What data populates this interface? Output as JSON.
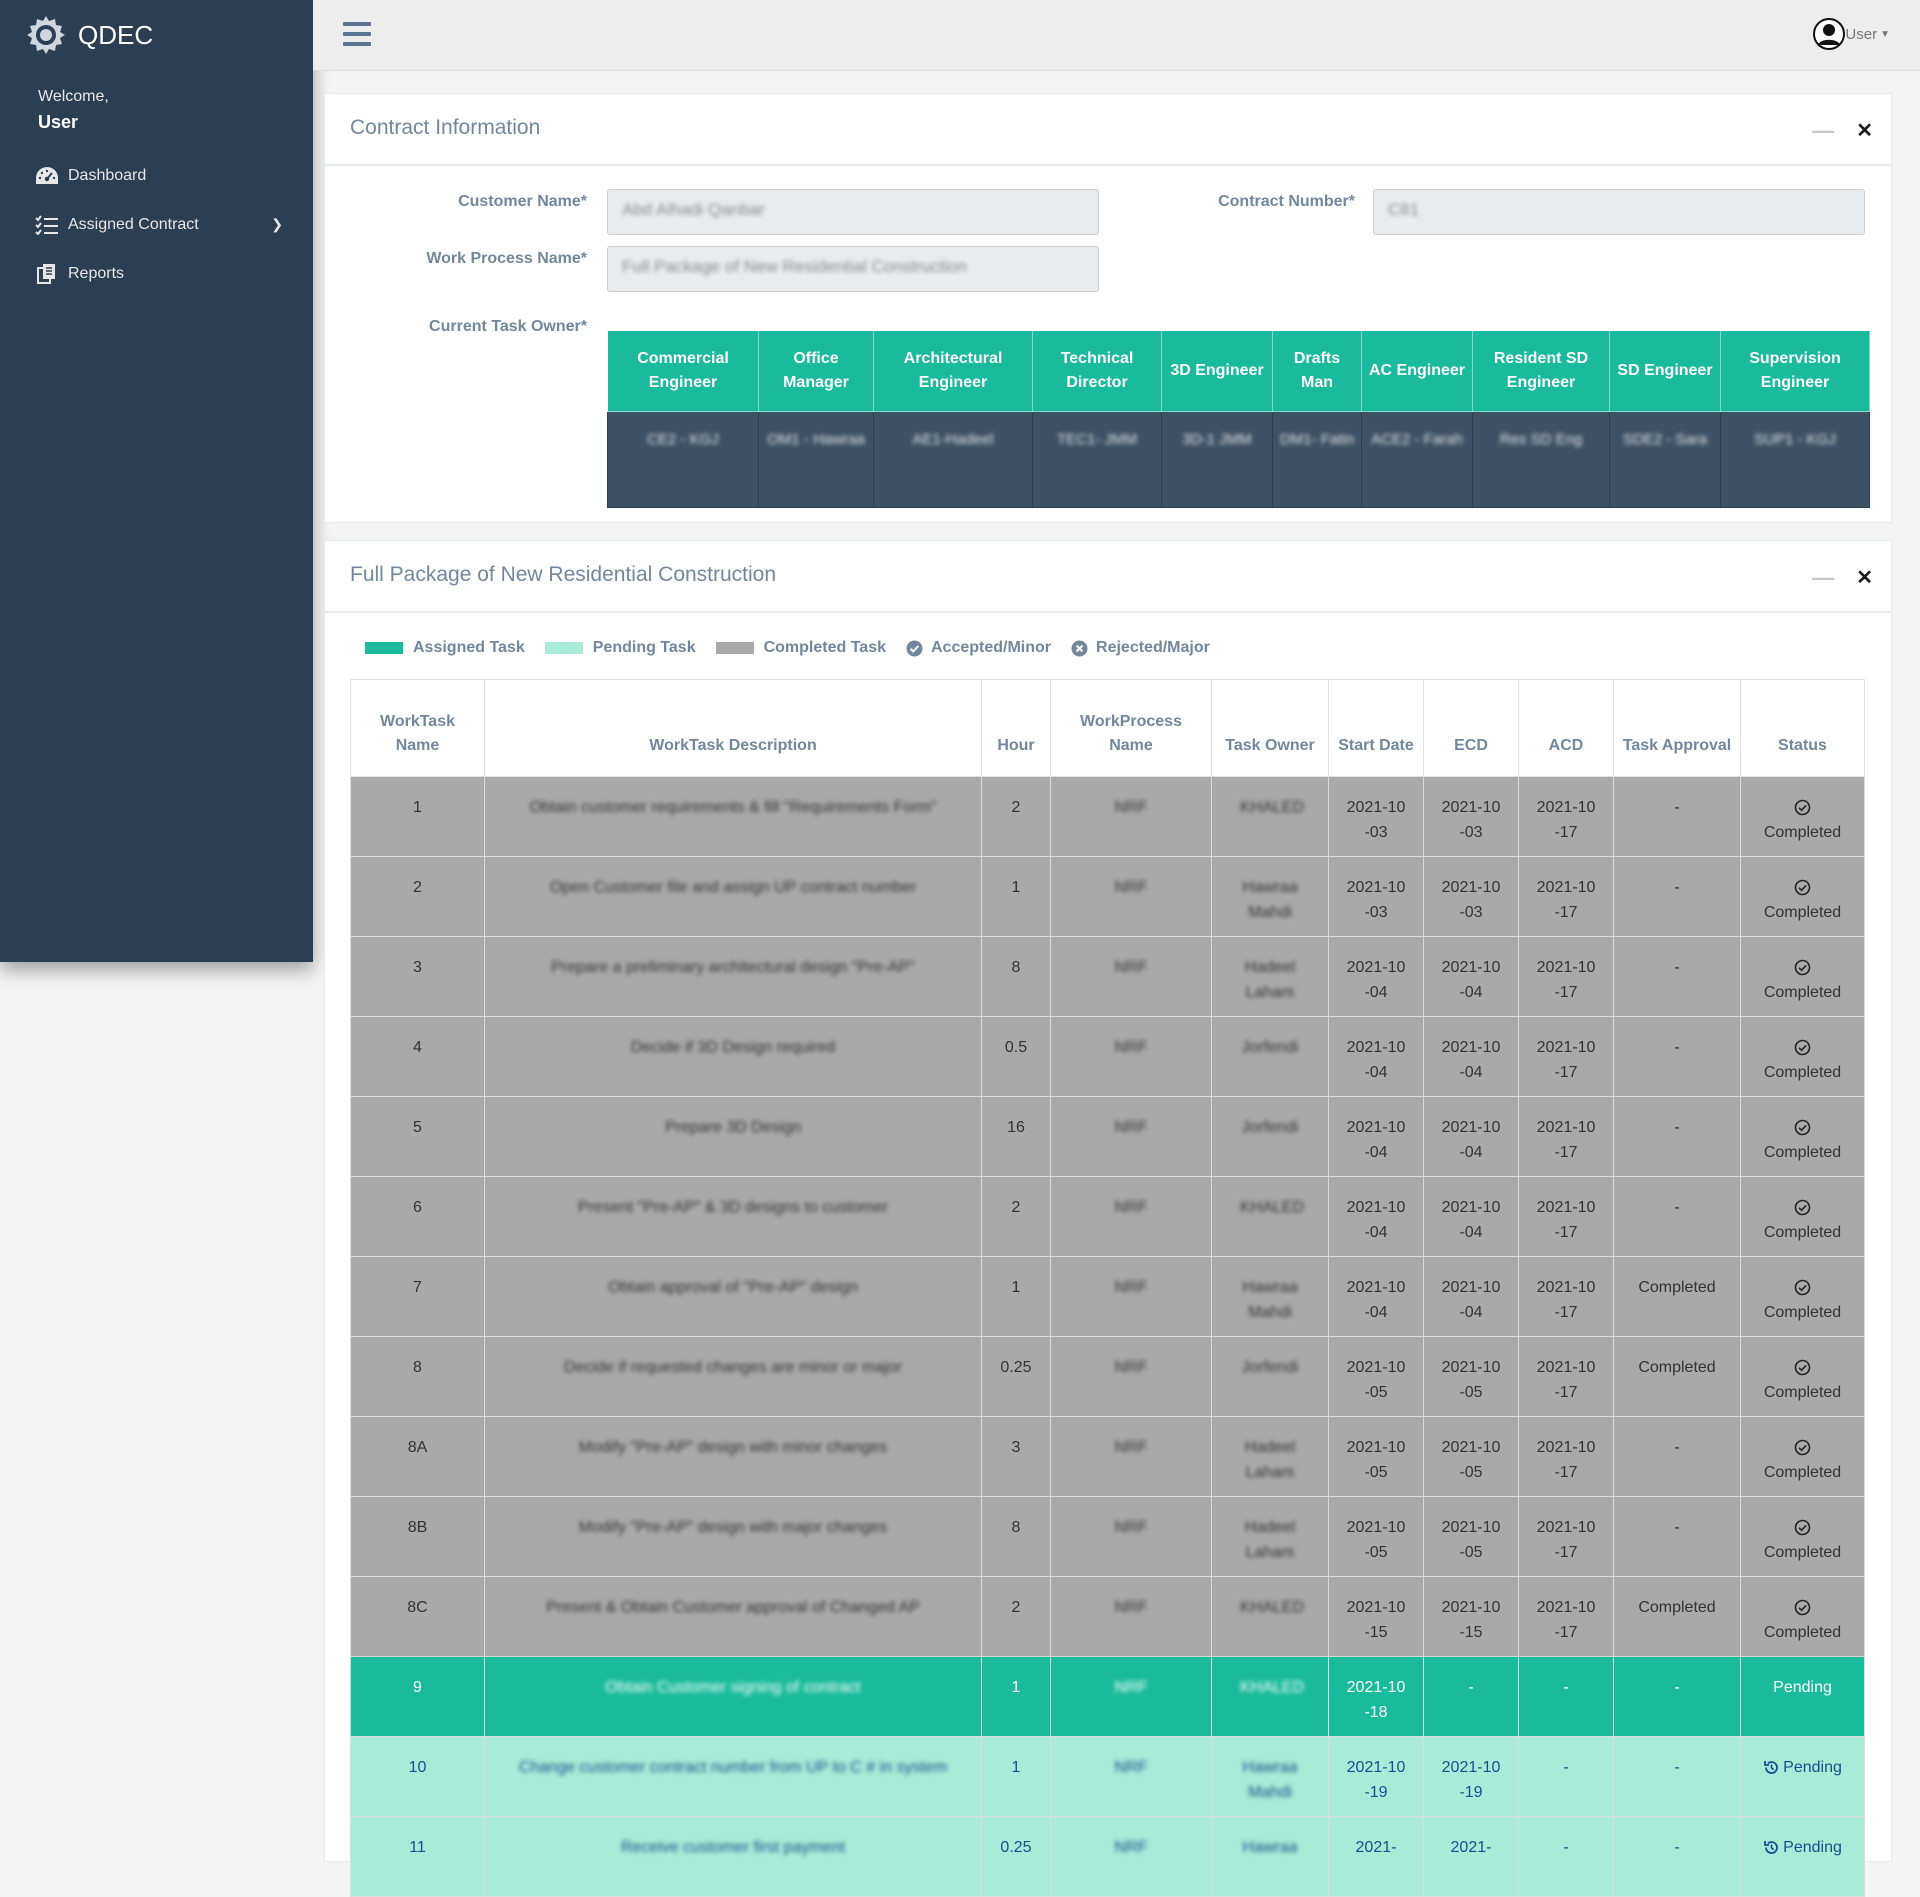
{
  "brand": {
    "name": "QDEC"
  },
  "sidebar": {
    "welcome": "Welcome,",
    "user": "User",
    "items": [
      {
        "label": "Dashboard",
        "icon": "dashboard-icon"
      },
      {
        "label": "Assigned Contract",
        "icon": "task-list-icon"
      },
      {
        "label": "Reports",
        "icon": "copy-icon"
      }
    ]
  },
  "topbar": {
    "user_label": "User"
  },
  "contract_panel": {
    "title": "Contract Information",
    "customer_name_label": "Customer Name*",
    "customer_name_value": "Abd Alhadi Qanbar",
    "contract_number_label": "Contract Number*",
    "contract_number_value": "C81",
    "work_process_label": "Work Process Name*",
    "work_process_value": "Full Package of New Residential Construction",
    "current_owner_label": "Current Task Owner*",
    "owners": [
      {
        "role": "Commercial Engineer",
        "name": "CE2 - KGJ"
      },
      {
        "role": "Office Manager",
        "name": "OM1 - Hawraa"
      },
      {
        "role": "Architectural Engineer",
        "name": "AE1-Hadeel"
      },
      {
        "role": "Technical Director",
        "name": "TEC1- JMM"
      },
      {
        "role": "3D Engineer",
        "name": "3D-1 JMM"
      },
      {
        "role": "Drafts Man",
        "name": "DM1- Fatin"
      },
      {
        "role": "AC Engineer",
        "name": "ACE2 - Farah"
      },
      {
        "role": "Resident SD Engineer",
        "name": "Res SD Eng"
      },
      {
        "role": "SD Engineer",
        "name": "SDE2 - Sara"
      },
      {
        "role": "Supervision Engineer",
        "name": "SUP1 - KGJ"
      }
    ]
  },
  "tasks_panel": {
    "title": "Full Package of New Residential Construction",
    "legend": {
      "assigned": "Assigned Task",
      "pending": "Pending Task",
      "completed": "Completed Task",
      "accepted": "Accepted/Minor",
      "rejected": "Rejected/Major"
    },
    "colors": {
      "assigned": "#1abb9c",
      "pending": "#a8ebd6",
      "completed": "#a9a9a9"
    },
    "headers": [
      "WorkTask Name",
      "WorkTask Description",
      "Hour",
      "WorkProcess Name",
      "Task Owner",
      "Start Date",
      "ECD",
      "ACD",
      "Task Approval",
      "Status"
    ],
    "rows": [
      {
        "name": "1",
        "desc": "Obtain customer requirements & fill \"Requirements Form\"",
        "hour": "2",
        "wp": "NRF",
        "owner": "KHALED",
        "start": "2021-10-03",
        "ecd": "2021-10-03",
        "acd": "2021-10-17",
        "approval": "-",
        "status": "Completed",
        "state": "completed"
      },
      {
        "name": "2",
        "desc": "Open Customer file and assign UP contract number",
        "hour": "1",
        "wp": "NRF",
        "owner": "Hawraa Mahdi",
        "start": "2021-10-03",
        "ecd": "2021-10-03",
        "acd": "2021-10-17",
        "approval": "-",
        "status": "Completed",
        "state": "completed"
      },
      {
        "name": "3",
        "desc": "Prepare a preliminary architectural design \"Pre-AP\"",
        "hour": "8",
        "wp": "NRF",
        "owner": "Hadeel Laham",
        "start": "2021-10-04",
        "ecd": "2021-10-04",
        "acd": "2021-10-17",
        "approval": "-",
        "status": "Completed",
        "state": "completed"
      },
      {
        "name": "4",
        "desc": "Decide if 3D Design required",
        "hour": "0.5",
        "wp": "NRF",
        "owner": "Jorfendi",
        "start": "2021-10-04",
        "ecd": "2021-10-04",
        "acd": "2021-10-17",
        "approval": "-",
        "status": "Completed",
        "state": "completed"
      },
      {
        "name": "5",
        "desc": "Prepare 3D Design",
        "hour": "16",
        "wp": "NRF",
        "owner": "Jorfendi",
        "start": "2021-10-04",
        "ecd": "2021-10-04",
        "acd": "2021-10-17",
        "approval": "-",
        "status": "Completed",
        "state": "completed"
      },
      {
        "name": "6",
        "desc": "Present \"Pre-AP\" & 3D designs to customer",
        "hour": "2",
        "wp": "NRF",
        "owner": "KHALED",
        "start": "2021-10-04",
        "ecd": "2021-10-04",
        "acd": "2021-10-17",
        "approval": "-",
        "status": "Completed",
        "state": "completed"
      },
      {
        "name": "7",
        "desc": "Obtain approval of \"Pre-AP\" design",
        "hour": "1",
        "wp": "NRF",
        "owner": "Hawraa Mahdi",
        "start": "2021-10-04",
        "ecd": "2021-10-04",
        "acd": "2021-10-17",
        "approval": "Completed",
        "status": "Completed",
        "state": "completed"
      },
      {
        "name": "8",
        "desc": "Decide if requested changes are minor or major",
        "hour": "0.25",
        "wp": "NRF",
        "owner": "Jorfendi",
        "start": "2021-10-05",
        "ecd": "2021-10-05",
        "acd": "2021-10-17",
        "approval": "Completed",
        "status": "Completed",
        "state": "completed"
      },
      {
        "name": "8A",
        "desc": "Modify \"Pre-AP\" design with minor changes",
        "hour": "3",
        "wp": "NRF",
        "owner": "Hadeel Laham",
        "start": "2021-10-05",
        "ecd": "2021-10-05",
        "acd": "2021-10-17",
        "approval": "-",
        "status": "Completed",
        "state": "completed"
      },
      {
        "name": "8B",
        "desc": "Modify \"Pre-AP\" design with major changes",
        "hour": "8",
        "wp": "NRF",
        "owner": "Hadeel Laham",
        "start": "2021-10-05",
        "ecd": "2021-10-05",
        "acd": "2021-10-17",
        "approval": "-",
        "status": "Completed",
        "state": "completed"
      },
      {
        "name": "8C",
        "desc": "Present & Obtain Customer approval of Changed AP",
        "hour": "2",
        "wp": "NRF",
        "owner": "KHALED",
        "start": "2021-10-15",
        "ecd": "2021-10-15",
        "acd": "2021-10-17",
        "approval": "Completed",
        "status": "Completed",
        "state": "completed"
      },
      {
        "name": "9",
        "desc": "Obtain Customer signing of contract",
        "hour": "1",
        "wp": "NRF",
        "owner": "KHALED",
        "start": "2021-10-18",
        "ecd": "-",
        "acd": "-",
        "approval": "-",
        "status": "Pending",
        "state": "assigned"
      },
      {
        "name": "10",
        "desc": "Change customer contract number from UP to C # in system",
        "hour": "1",
        "wp": "NRF",
        "owner": "Hawraa Mahdi",
        "start": "2021-10-19",
        "ecd": "2021-10-19",
        "acd": "-",
        "approval": "-",
        "status": "Pending",
        "state": "pending"
      },
      {
        "name": "11",
        "desc": "Receive customer first payment",
        "hour": "0.25",
        "wp": "NRF",
        "owner": "Hawraa",
        "start": "2021-",
        "ecd": "2021-",
        "acd": "-",
        "approval": "-",
        "status": "Pending",
        "state": "pending"
      }
    ]
  }
}
